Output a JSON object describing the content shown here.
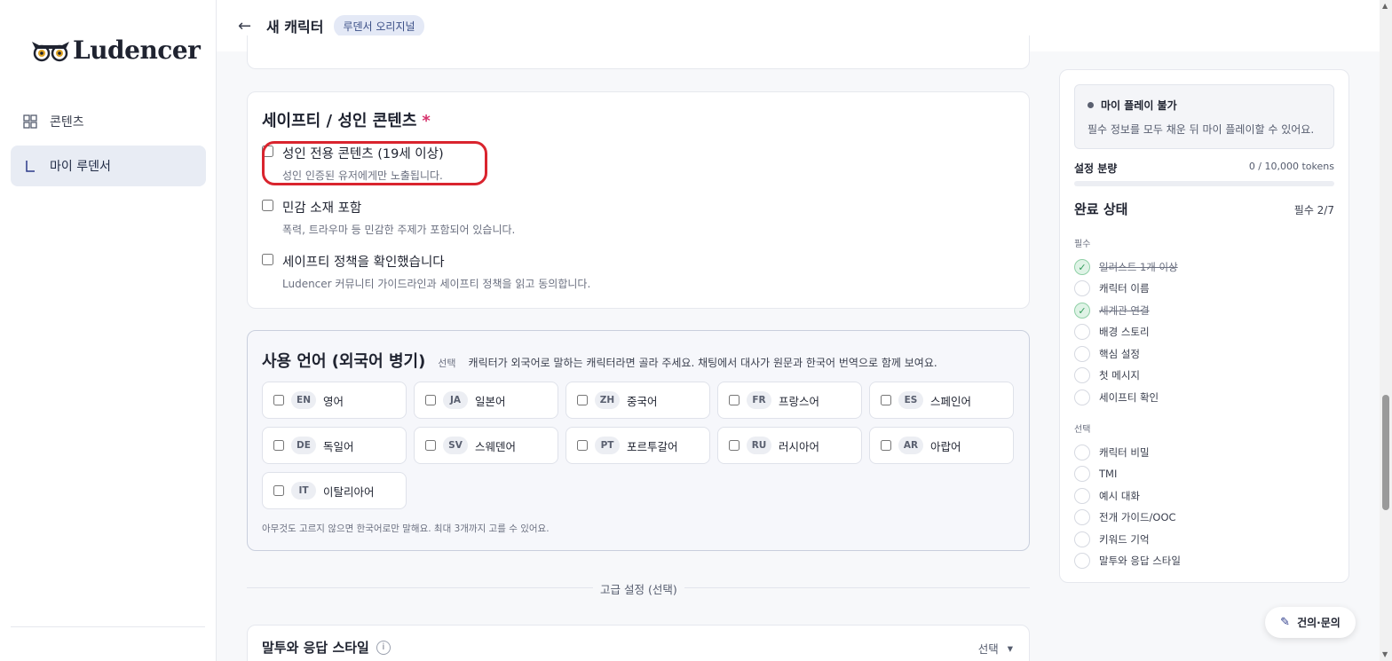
{
  "brand": {
    "wordmark": "Ludencer"
  },
  "sidebar": {
    "items": [
      {
        "label": "콘텐츠",
        "icon": "grid-icon"
      },
      {
        "label": "마이 루덴서",
        "icon": "corner-icon"
      }
    ]
  },
  "header": {
    "back_icon": "←",
    "title": "새 캐릭터",
    "badge": "루덴서 오리지널"
  },
  "safety": {
    "title": "세이프티 / 성인 콘텐츠",
    "required_mark": "*",
    "options": [
      {
        "title": "성인 전용 콘텐츠 (19세 이상)",
        "desc": "성인 인증된 유저에게만 노출됩니다.",
        "checked": false
      },
      {
        "title": "민감 소재 포함",
        "desc": "폭력, 트라우마 등 민감한 주제가 포함되어 있습니다.",
        "checked": false
      },
      {
        "title": "세이프티 정책을 확인했습니다",
        "desc": "Ludencer 커뮤니티 가이드라인과 세이프티 정책을 읽고 동의합니다.",
        "checked": false
      }
    ]
  },
  "languages": {
    "title": "사용 언어 (외국어 병기)",
    "optional": "선택",
    "desc": "캐릭터가 외국어로 말하는 캐릭터라면 골라 주세요. 채팅에서 대사가 원문과 한국어 번역으로 함께 보여요.",
    "items": [
      {
        "code": "EN",
        "name": "영어"
      },
      {
        "code": "JA",
        "name": "일본어"
      },
      {
        "code": "ZH",
        "name": "중국어"
      },
      {
        "code": "FR",
        "name": "프랑스어"
      },
      {
        "code": "ES",
        "name": "스페인어"
      },
      {
        "code": "DE",
        "name": "독일어"
      },
      {
        "code": "SV",
        "name": "스웨덴어"
      },
      {
        "code": "PT",
        "name": "포르투갈어"
      },
      {
        "code": "RU",
        "name": "러시아어"
      },
      {
        "code": "AR",
        "name": "아랍어"
      },
      {
        "code": "IT",
        "name": "이탈리아어"
      }
    ],
    "hint": "아무것도 고르지 않으면 한국어로만 말해요. 최대 3개까지 고를 수 있어요."
  },
  "advanced": {
    "label": "고급 설정 (선택)"
  },
  "tone": {
    "title": "말투와 응답 스타일",
    "info_icon": "i",
    "select_label": "선택",
    "chevron": "▾"
  },
  "panel": {
    "status_title": "마이 플레이 불가",
    "status_msg": "필수 정보를 모두 채운 뒤 마이 플레이할 수 있어요.",
    "amount_label": "설정 분량",
    "amount_value": "0 / 10,000 tokens",
    "amount_fraction": 0,
    "done_title": "완료 상태",
    "done_count": "필수 2/7",
    "required_label": "필수",
    "optional_label": "선택",
    "required_items": [
      {
        "label": "일러스트 1개 이상",
        "done": true
      },
      {
        "label": "캐릭터 이름",
        "done": false
      },
      {
        "label": "세계관 연결",
        "done": true
      },
      {
        "label": "배경 스토리",
        "done": false
      },
      {
        "label": "핵심 설정",
        "done": false
      },
      {
        "label": "첫 메시지",
        "done": false
      },
      {
        "label": "세이프티 확인",
        "done": false
      }
    ],
    "optional_items": [
      {
        "label": "캐릭터 비밀",
        "done": false
      },
      {
        "label": "TMI",
        "done": false
      },
      {
        "label": "예시 대화",
        "done": false
      },
      {
        "label": "전개 가이드/OOC",
        "done": false
      },
      {
        "label": "키워드 기억",
        "done": false
      },
      {
        "label": "말투와 응답 스타일",
        "done": false
      }
    ]
  },
  "feedback": {
    "label": "건의·문의",
    "icon": "pencil-icon"
  }
}
